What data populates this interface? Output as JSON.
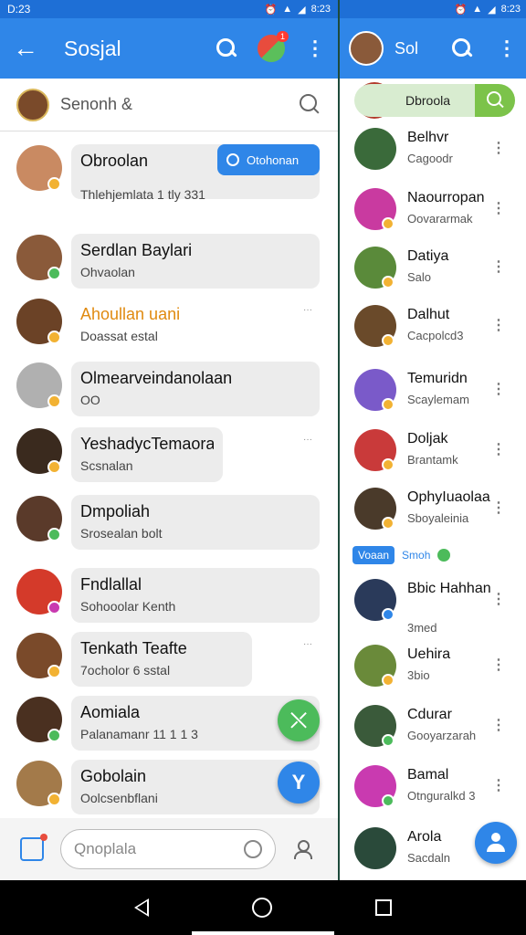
{
  "status_left": {
    "time": "D:23",
    "battery": "8:23"
  },
  "status_right": {
    "time": "8:23"
  },
  "appbar_left": {
    "title": "Sosjal",
    "notif_badge": "1"
  },
  "appbar_right": {
    "title": "Sol"
  },
  "search": {
    "placeholder": "Senonh &"
  },
  "tooltip": {
    "label": "Otohonan"
  },
  "chats": [
    {
      "name": "Obroolan",
      "preview": "Thlehjemlata 1 tly 331",
      "avatar_color": "#c98a62"
    },
    {
      "name": "Serdlan Baylari",
      "preview": "Ohvaolan",
      "avatar_color": "#8a5a3a"
    },
    {
      "name": "Ahoullan uani",
      "preview": "Doassat estal",
      "avatar_color": "#6b4226"
    },
    {
      "name": "Olmearveindanolaan",
      "preview": "OO",
      "avatar_color": "#b0b0b0"
    },
    {
      "name": "YeshadycTemaora",
      "preview": "Scsnalan",
      "avatar_color": "#3a2a1e"
    },
    {
      "name": "Dmpoliah",
      "preview": "Srosealan bolt",
      "avatar_color": "#5a3a2a"
    },
    {
      "name": "Fndlallal",
      "preview": "Sohooolar Kenth",
      "avatar_color": "#d43a2a"
    },
    {
      "name": "Tenkath Teafte",
      "preview": "7ocholor 6 sstal",
      "avatar_color": "#7a4a2a"
    },
    {
      "name": "Aomiala",
      "preview": "Palanamanr 11 1 1 3",
      "avatar_color": "#4a3020"
    },
    {
      "name": "Gobolain",
      "preview": "Oolcsenbflani",
      "avatar_color": "#a37a4a"
    }
  ],
  "contacts": [
    {
      "name": "Belhvr",
      "sub": "Cagoodr",
      "avatar_color": "#3a6a3a"
    },
    {
      "name": "Naourropan",
      "sub": "Oovararmak",
      "avatar_color": "#c93aa0"
    },
    {
      "name": "Datiya",
      "sub": "Salo",
      "avatar_color": "#5a8a3a"
    },
    {
      "name": "Dalhut",
      "sub": "Cacpolcd3",
      "avatar_color": "#6a4a2a"
    },
    {
      "name": "Temuridn",
      "sub": "Scaylemam",
      "avatar_color": "#7a5ac9"
    },
    {
      "name": "Doljak",
      "sub": "Brantamk",
      "avatar_color": "#c93a3a"
    },
    {
      "name": "OphyIuaolaa",
      "sub": "Sboyaleinia",
      "avatar_color": "#4a3a2a"
    },
    {
      "name": "Bbic Hahhan",
      "sub": "3med",
      "avatar_color": "#2a3a5a"
    },
    {
      "name": "Uehira",
      "sub": "3bio",
      "avatar_color": "#6a8a3a"
    },
    {
      "name": "Cdurar",
      "sub": "Gooyarzarah",
      "avatar_color": "#3a5a3a"
    },
    {
      "name": "Bamal",
      "sub": "Otnguralkd 3",
      "avatar_color": "#c93ab0"
    },
    {
      "name": "Arola",
      "sub": "Sacdaln",
      "avatar_color": "#2a4a3a"
    }
  ],
  "side_search": {
    "label": "Dbroola"
  },
  "section": {
    "chip": "Voaan",
    "label": "Smoh"
  },
  "composer": {
    "placeholder": "Qnoplala"
  }
}
